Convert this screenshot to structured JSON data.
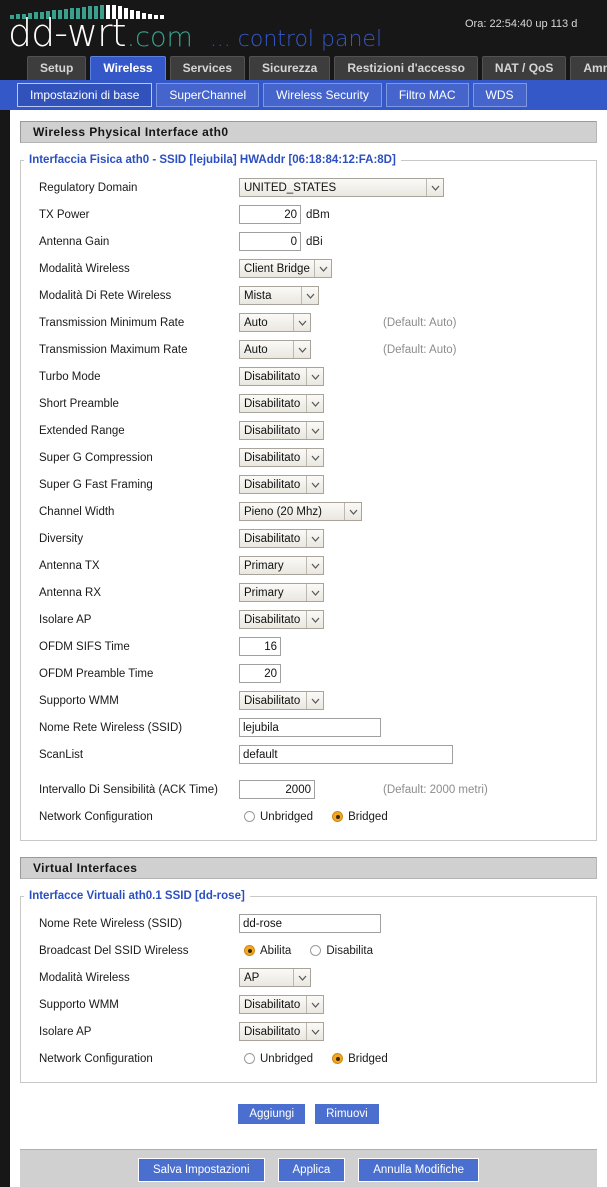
{
  "header": {
    "logo_main": "dd-wrt",
    "logo_tld": ".com",
    "logo_subtitle": "... control panel",
    "status": "Ora: 22:54:40 up 113 d"
  },
  "main_tabs": [
    {
      "label": "Setup",
      "active": false
    },
    {
      "label": "Wireless",
      "active": true
    },
    {
      "label": "Services",
      "active": false
    },
    {
      "label": "Sicurezza",
      "active": false
    },
    {
      "label": "Restizioni d'accesso",
      "active": false
    },
    {
      "label": "NAT / QoS",
      "active": false
    },
    {
      "label": "Amministrazione",
      "active": false
    }
  ],
  "sub_tabs": [
    {
      "label": "Impostazioni di base",
      "active": true
    },
    {
      "label": "SuperChannel",
      "active": false
    },
    {
      "label": "Wireless Security",
      "active": false
    },
    {
      "label": "Filtro MAC",
      "active": false
    },
    {
      "label": "WDS",
      "active": false
    }
  ],
  "physical": {
    "section_title": "Wireless Physical Interface ath0",
    "legend": "Interfaccia Fisica ath0 - SSID [lejubila] HWAddr [06:18:84:12:FA:8D]",
    "rows": {
      "regulatory_domain": {
        "label": "Regulatory Domain",
        "value": "UNITED_STATES"
      },
      "tx_power": {
        "label": "TX Power",
        "value": "20",
        "unit": "dBm"
      },
      "antenna_gain": {
        "label": "Antenna Gain",
        "value": "0",
        "unit": "dBi"
      },
      "wireless_mode": {
        "label": "Modalità Wireless",
        "value": "Client Bridge"
      },
      "network_mode": {
        "label": "Modalità Di Rete Wireless",
        "value": "Mista"
      },
      "tx_min_rate": {
        "label": "Transmission Minimum Rate",
        "value": "Auto",
        "hint": "(Default: Auto)"
      },
      "tx_max_rate": {
        "label": "Transmission Maximum Rate",
        "value": "Auto",
        "hint": "(Default: Auto)"
      },
      "turbo_mode": {
        "label": "Turbo Mode",
        "value": "Disabilitato"
      },
      "short_preamble": {
        "label": "Short Preamble",
        "value": "Disabilitato"
      },
      "extended_range": {
        "label": "Extended Range",
        "value": "Disabilitato"
      },
      "superg_compression": {
        "label": "Super G Compression",
        "value": "Disabilitato"
      },
      "superg_fast_framing": {
        "label": "Super G Fast Framing",
        "value": "Disabilitato"
      },
      "channel_width": {
        "label": "Channel Width",
        "value": "Pieno (20 Mhz)"
      },
      "diversity": {
        "label": "Diversity",
        "value": "Disabilitato"
      },
      "antenna_tx": {
        "label": "Antenna TX",
        "value": "Primary"
      },
      "antenna_rx": {
        "label": "Antenna RX",
        "value": "Primary"
      },
      "isolate_ap": {
        "label": "Isolare AP",
        "value": "Disabilitato"
      },
      "ofdm_sifs": {
        "label": "OFDM SIFS Time",
        "value": "16"
      },
      "ofdm_preamble": {
        "label": "OFDM Preamble Time",
        "value": "20"
      },
      "wmm_support": {
        "label": "Supporto WMM",
        "value": "Disabilitato"
      },
      "ssid": {
        "label": "Nome Rete Wireless (SSID)",
        "value": "lejubila"
      },
      "scanlist": {
        "label": "ScanList",
        "value": "default"
      },
      "ack_time": {
        "label": "Intervallo Di Sensibilità (ACK Time)",
        "value": "2000",
        "hint": "(Default: 2000 metri)"
      },
      "network_config": {
        "label": "Network Configuration",
        "options": [
          {
            "label": "Unbridged",
            "selected": false
          },
          {
            "label": "Bridged",
            "selected": true
          }
        ]
      }
    }
  },
  "virtual": {
    "section_title": "Virtual Interfaces",
    "legend": "Interfacce Virtuali ath0.1 SSID [dd-rose]",
    "rows": {
      "ssid": {
        "label": "Nome Rete Wireless (SSID)",
        "value": "dd-rose"
      },
      "ssid_broadcast": {
        "label": "Broadcast Del SSID Wireless",
        "options": [
          {
            "label": "Abilita",
            "selected": true
          },
          {
            "label": "Disabilita",
            "selected": false
          }
        ]
      },
      "wireless_mode": {
        "label": "Modalità Wireless",
        "value": "AP"
      },
      "wmm_support": {
        "label": "Supporto WMM",
        "value": "Disabilitato"
      },
      "isolate_ap": {
        "label": "Isolare AP",
        "value": "Disabilitato"
      },
      "network_config": {
        "label": "Network Configuration",
        "options": [
          {
            "label": "Unbridged",
            "selected": false
          },
          {
            "label": "Bridged",
            "selected": true
          }
        ]
      }
    },
    "add_button": "Aggiungi",
    "remove_button": "Rimuovi"
  },
  "footer": {
    "save_label": "Salva Impostazioni",
    "apply_label": "Applica",
    "cancel_label": "Annulla Modifiche"
  },
  "colors": {
    "accent_blue": "#3558c8",
    "logo_teal": "#3aa08d",
    "radio_on": "#f5a623",
    "button_blue": "#4a6fcf"
  }
}
